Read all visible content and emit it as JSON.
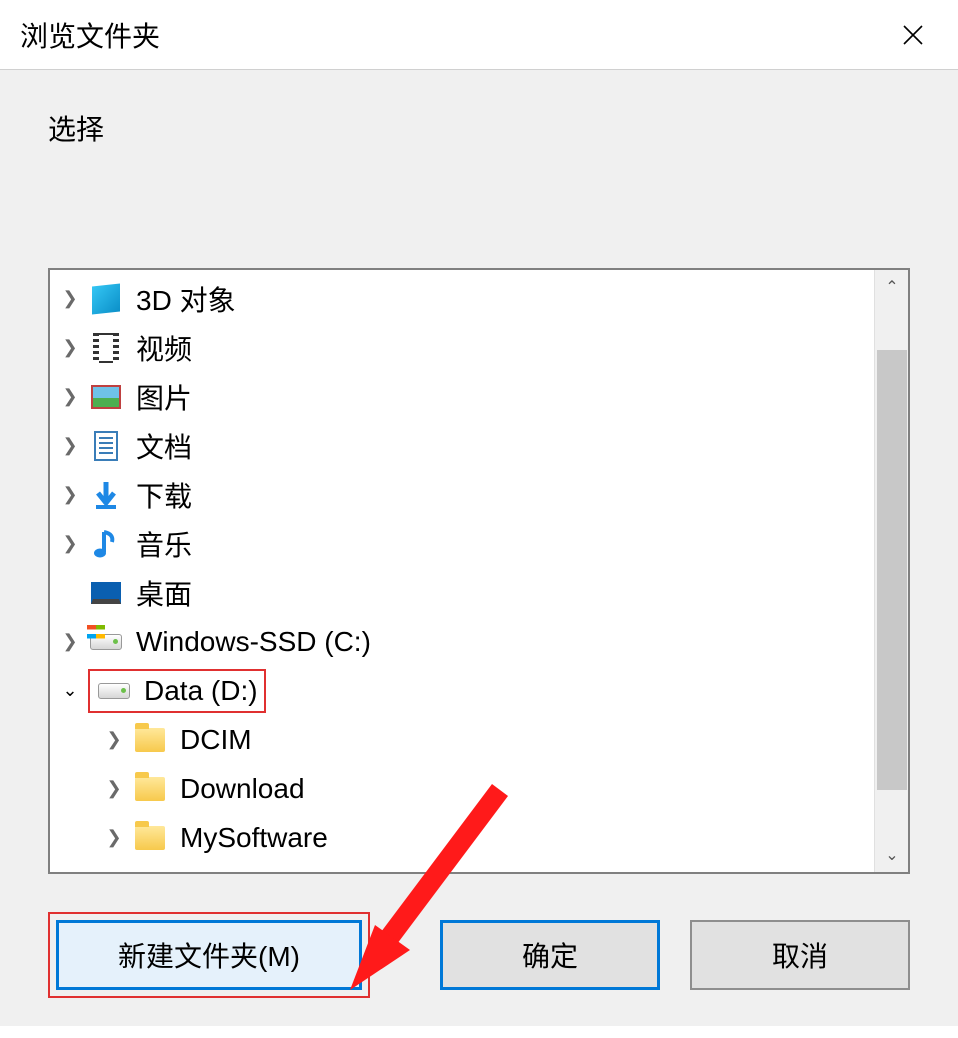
{
  "dialog": {
    "title": "浏览文件夹",
    "instruction": "选择"
  },
  "tree": {
    "items": [
      {
        "label": "3D 对象",
        "icon": "3d-objects-icon",
        "expander": "right",
        "level": 0
      },
      {
        "label": "视频",
        "icon": "videos-icon",
        "expander": "right",
        "level": 0
      },
      {
        "label": "图片",
        "icon": "pictures-icon",
        "expander": "right",
        "level": 0
      },
      {
        "label": "文档",
        "icon": "documents-icon",
        "expander": "right",
        "level": 0
      },
      {
        "label": "下载",
        "icon": "downloads-icon",
        "expander": "right",
        "level": 0
      },
      {
        "label": "音乐",
        "icon": "music-icon",
        "expander": "right",
        "level": 0
      },
      {
        "label": "桌面",
        "icon": "desktop-icon",
        "expander": "none",
        "level": 0
      },
      {
        "label": "Windows-SSD (C:)",
        "icon": "drive-c-icon",
        "expander": "right",
        "level": 0
      },
      {
        "label": "Data (D:)",
        "icon": "drive-d-icon",
        "expander": "down",
        "level": 0,
        "selected": true
      },
      {
        "label": "DCIM",
        "icon": "folder-icon",
        "expander": "right",
        "level": 1
      },
      {
        "label": "Download",
        "icon": "folder-icon",
        "expander": "right",
        "level": 1
      },
      {
        "label": "MySoftware",
        "icon": "folder-icon",
        "expander": "right",
        "level": 1
      }
    ]
  },
  "buttons": {
    "new_folder": "新建文件夹(M)",
    "ok": "确定",
    "cancel": "取消"
  }
}
